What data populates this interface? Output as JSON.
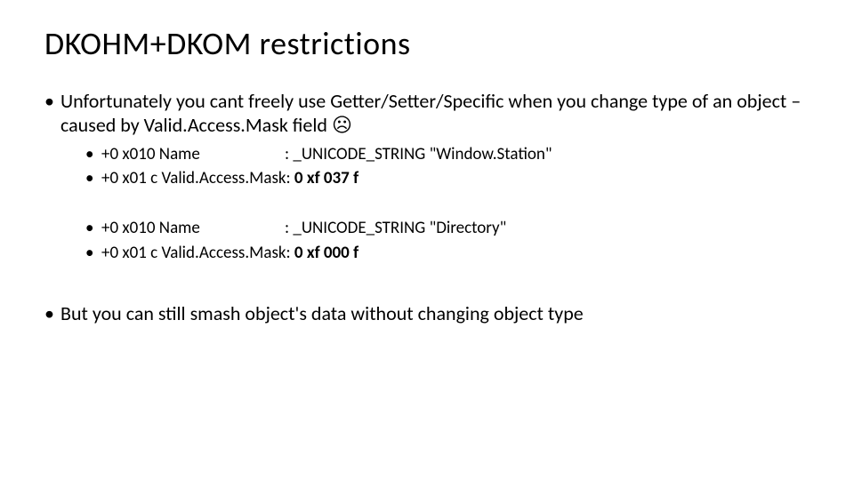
{
  "title": "DKOHM+DKOM restrictions",
  "bullets": {
    "b1_part1": "Unfortunately you cant freely use Getter/Setter/Specific when you change type of an object – caused by Valid.Access.Mask field ",
    "b1_sad": "☹",
    "sub1_label": "+0 x010 Name",
    "sub1_sep": ": ",
    "sub1_val": "_UNICODE_STRING \"Window.Station\"",
    "sub2_label": "+0 x01 c Valid.Access.Mask",
    "sub2_sep": ": ",
    "sub2_val": "0 xf 037 f",
    "sub3_label": "+0 x010 Name",
    "sub3_sep": ": ",
    "sub3_val": "_UNICODE_STRING \"Directory\"",
    "sub4_label": "+0 x01 c Valid.Access.Mask",
    "sub4_sep": ": ",
    "sub4_val": "0 xf 000 f",
    "b2": "But you can still smash object's data without changing object type"
  }
}
